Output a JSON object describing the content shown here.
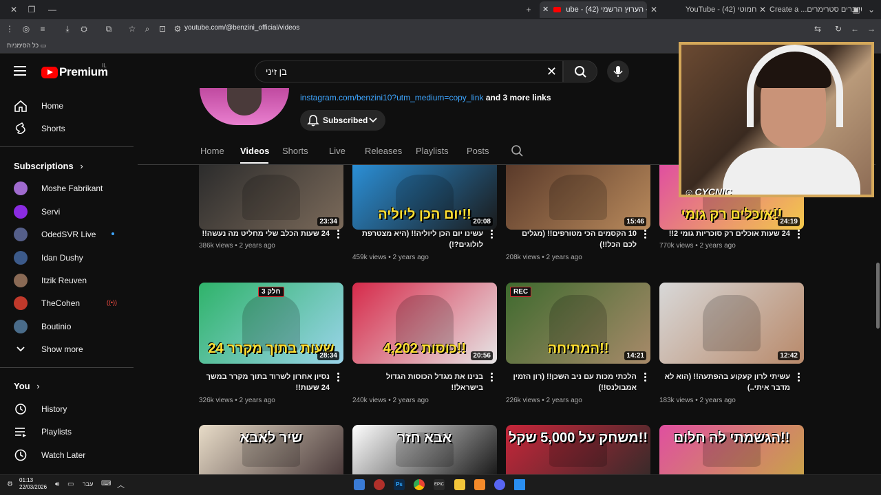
{
  "browser": {
    "tabs": [
      {
        "label": "ube - בן זיני - הערוץ הרשמי (42)",
        "active": true
      },
      {
        "label": "YouTube - חמוטי (42)",
        "active": false
      },
      {
        "label": "Create a ...יוטיוברים סטרימרים",
        "active": false
      }
    ],
    "url": "youtube.com/@benzini_official/videos",
    "bookmarks_label": "כל הסימניות"
  },
  "header": {
    "logo_text": "Premium",
    "country_code": "IL",
    "search_value": "בן זיני"
  },
  "sidebar": {
    "main": [
      {
        "label": "Home",
        "icon": "home-icon"
      },
      {
        "label": "Shorts",
        "icon": "shorts-icon"
      }
    ],
    "subscriptions_title": "Subscriptions",
    "subscriptions": [
      {
        "label": "Moshe Fabrikant",
        "color": "#a06bcf"
      },
      {
        "label": "Servi",
        "color": "#8a2be2"
      },
      {
        "label": "OdedSVR Live",
        "color": "#555f8a",
        "live": true
      },
      {
        "label": "Idan Dushy",
        "color": "#3c5a8a"
      },
      {
        "label": "Itzik Reuven",
        "color": "#8a6a55"
      },
      {
        "label": "TheCohen",
        "color": "#c0392b",
        "badge": true
      },
      {
        "label": "Boutinio",
        "color": "#4a6c8a"
      }
    ],
    "show_more": "Show more",
    "you_title": "You",
    "you_items": [
      {
        "label": "History",
        "icon": "history-icon"
      },
      {
        "label": "Playlists",
        "icon": "playlists-icon"
      },
      {
        "label": "Watch Later",
        "icon": "watch-later-icon"
      }
    ]
  },
  "channel": {
    "link_text": "instagram.com/benzini10?utm_medium=copy_link",
    "more_links": "and 3 more links",
    "subscribed_label": "Subscribed",
    "tabs": [
      "Home",
      "Videos",
      "Shorts",
      "Live",
      "Releases",
      "Playlists",
      "Posts"
    ],
    "active_tab": "Videos"
  },
  "videos": [
    {
      "title": "24 שעות הכלב שלי מחליט מה נעשה!!",
      "views": "386k views",
      "age": "2 years ago",
      "duration": "23:34",
      "overlay": "",
      "colors": [
        "#2c2c2c",
        "#7b6a5a"
      ]
    },
    {
      "title": "עשינו יום הכן ליוליה!! (היא מצטרפת לולוגים?!)",
      "views": "459k views",
      "age": "2 years ago",
      "duration": "20:08",
      "overlay": "יום הכן ליוליה!!",
      "colors": [
        "#2b8fd6",
        "#1a1a1a"
      ]
    },
    {
      "title": "10 הקסמים הכי מטורפים!! (מגלים לכם הכל!!)",
      "views": "208k views",
      "age": "2 years ago",
      "duration": "15:46",
      "overlay": "",
      "colors": [
        "#5a3a2a",
        "#b98a5c"
      ]
    },
    {
      "title": "24 שעות אוכלים רק סוכריות גומי 2!!",
      "views": "770k views",
      "age": "2 years ago",
      "duration": "24:19",
      "overlay": "אוכלים רק גומי!!",
      "colors": [
        "#e04fa0",
        "#f3c94a"
      ]
    },
    {
      "title": "נסיון אחרון לשרוד בתוך מקרר במשך 24 שעות!!",
      "views": "326k views",
      "age": "2 years ago",
      "duration": "28:34",
      "overlay": "24 שעות בתוך מקרר",
      "badge": "חלק 3",
      "colors": [
        "#2fb36a",
        "#9ad4ea"
      ]
    },
    {
      "title": "בנינו את מגדל הכוסות הגדול בישראל!!",
      "views": "240k views",
      "age": "2 years ago",
      "duration": "20:56",
      "overlay": "4,202 כוסות!!",
      "colors": [
        "#d62a4a",
        "#e6e6e6"
      ]
    },
    {
      "title": "הלכתי מכות עם ניב השכן!! (רון הזמין אמבולנס!!)",
      "views": "226k views",
      "age": "2 years ago",
      "duration": "14:21",
      "overlay": "המתיחה!!",
      "badge": "REC",
      "colors": [
        "#3e6a2e",
        "#a88a6a"
      ]
    },
    {
      "title": "עשיתי לרון קעקוע בהפתעה!! (הוא לא מדבר איתי..)",
      "views": "183k views",
      "age": "2 years ago",
      "duration": "12:42",
      "overlay": "",
      "colors": [
        "#d8d8d8",
        "#b8896a"
      ]
    },
    {
      "title": "",
      "views": "",
      "age": "",
      "duration": "",
      "overlay": "שיר לאבא",
      "colors": [
        "#e8dcc8",
        "#4a3a3a"
      ]
    },
    {
      "title": "",
      "views": "",
      "age": "",
      "duration": "",
      "overlay": "אבא חזר",
      "colors": [
        "#ffffff",
        "#1a1a1a"
      ]
    },
    {
      "title": "",
      "views": "",
      "age": "",
      "duration": "",
      "overlay": "משחק על 5,000 שקל!!",
      "colors": [
        "#c7263a",
        "#3a2a2a"
      ]
    },
    {
      "title": "",
      "views": "",
      "age": "",
      "duration": "",
      "overlay": "הגשמתי לה חלום!!",
      "colors": [
        "#e04fa0",
        "#c9a24a"
      ]
    }
  ],
  "webcam": {
    "tag": "CYCNIC"
  },
  "taskbar": {
    "time": "01:13",
    "date": "22/03/2026",
    "lang": "עבר"
  }
}
